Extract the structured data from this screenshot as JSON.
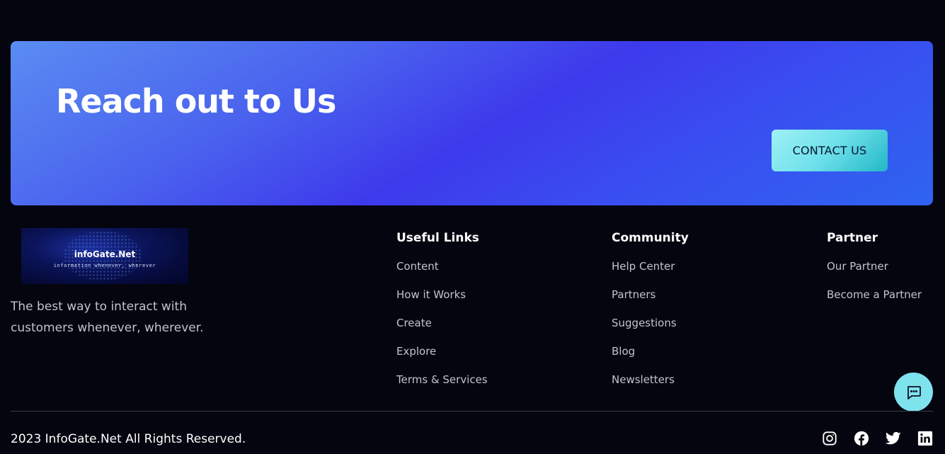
{
  "cta": {
    "title": "Reach out to Us",
    "button_label": "CONTACT US"
  },
  "brand": {
    "logo_name": "infoGate.Net",
    "logo_tagline": "information whenever, wherever",
    "description": "The best way to interact with customers whenever, wherever."
  },
  "columns": [
    {
      "heading": "Useful Links",
      "links": [
        "Content",
        "How it Works",
        "Create",
        "Explore",
        "Terms & Services"
      ]
    },
    {
      "heading": "Community",
      "links": [
        "Help Center",
        "Partners",
        "Suggestions",
        "Blog",
        "Newsletters"
      ]
    },
    {
      "heading": "Partner",
      "links": [
        "Our Partner",
        "Become a Partner"
      ]
    }
  ],
  "chat": {
    "icon": "chat-bubble-icon"
  },
  "footer": {
    "copyright": "2023 InfoGate.Net All Rights Reserved.",
    "social_icons": [
      "instagram-icon",
      "facebook-icon",
      "twitter-icon",
      "linkedin-icon"
    ]
  },
  "colors": {
    "background": "#04050f",
    "banner_gradient_start": "#5a8cf2",
    "banner_gradient_mid": "#3d3aeb",
    "banner_gradient_end": "#2f64f0",
    "accent_cyan": "#7fe3ee",
    "muted_text": "#c2c4cc"
  }
}
